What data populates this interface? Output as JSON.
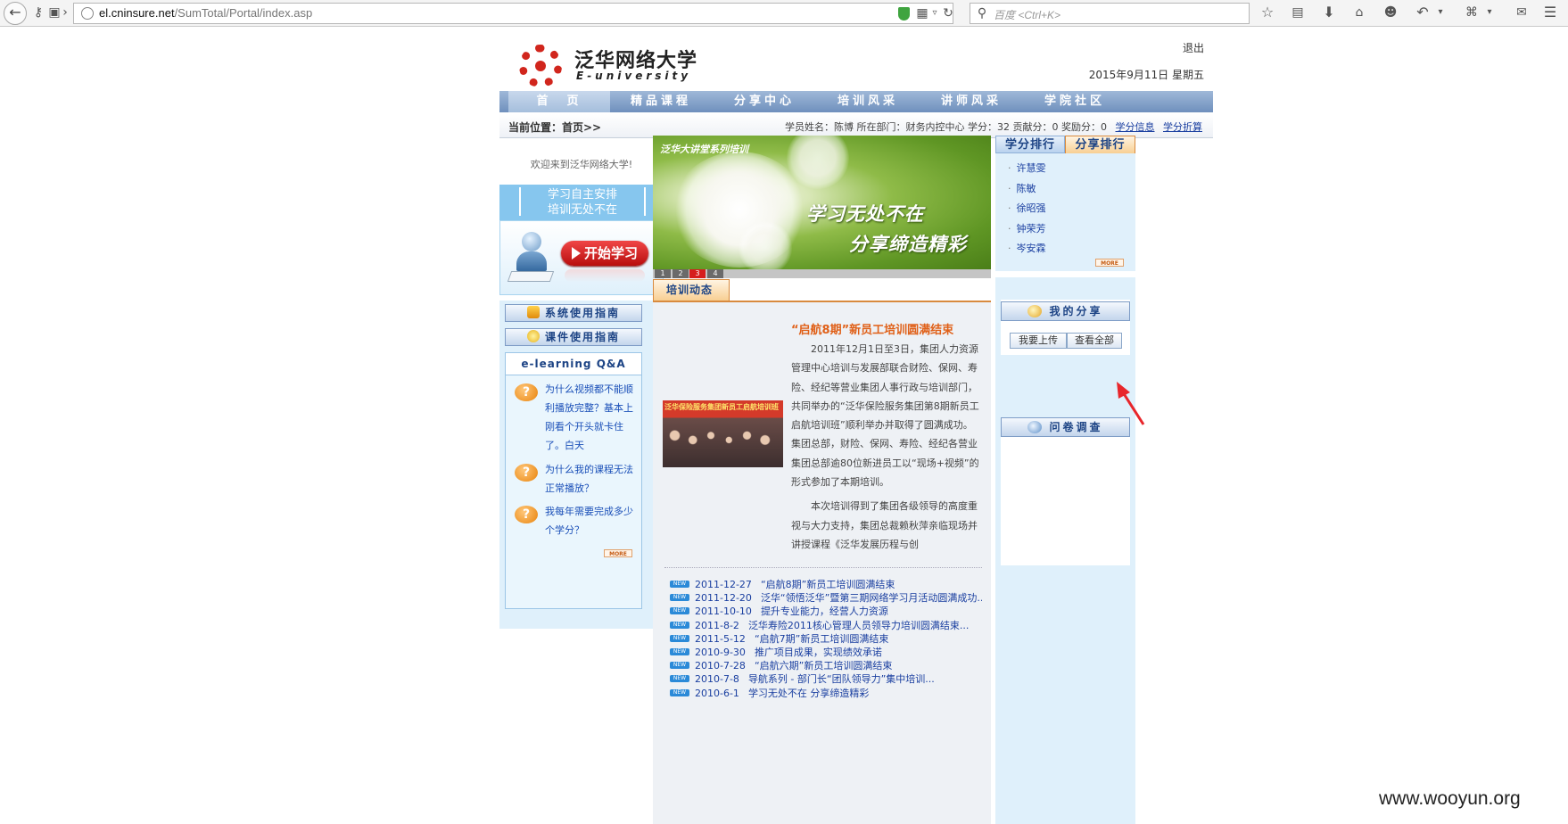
{
  "browser": {
    "url_host": "el.cninsure.net",
    "url_path": "/SumTotal/Portal/index.asp",
    "search_placeholder": "百度 <Ctrl+K>"
  },
  "header": {
    "logo_cn": "泛华网络大学",
    "logo_en": "E-university",
    "logout": "退出",
    "date": "2015年9月11日  星期五"
  },
  "nav": [
    "首　页",
    "精品课程",
    "分享中心",
    "培训风采",
    "讲师风采",
    "学院社区"
  ],
  "crumb": "当前位置：首页>>",
  "userinfo": {
    "text": "学员姓名：陈博  所在部门：财务内控中心  学分：32  贡献分：0  奖励分：0",
    "link1": "学分信息",
    "link2": "学分折算"
  },
  "left": {
    "welcome": "欢迎来到泛华网络大学!",
    "slogan1": "学习自主安排",
    "slogan2": "培训无处不在",
    "start_button": "开始学习",
    "guide1": "系统使用指南",
    "guide2": "课件使用指南",
    "qa_title": "e-learning Q&A",
    "qa": [
      "为什么视频都不能顺利播放完整？基本上刚看个开头就卡住了。白天",
      "为什么我的课程无法正常播放？",
      "我每年需要完成多少个学分？"
    ],
    "more": "MORE"
  },
  "banner": {
    "title": "泛华大讲堂系列培训",
    "line1": "学习无处不在",
    "line2": "分享缔造精彩",
    "pages": [
      "1",
      "2",
      "3",
      "4"
    ],
    "current_page": 3
  },
  "news": {
    "tab": "培训动态",
    "photo_caption": "泛华保险服务集团新员工启航培训班",
    "article_title": "“启航8期”新员工培训圆满结束",
    "article_p1": "2011年12月1日至3日，集团人力资源管理中心培训与发展部联合财险、保网、寿险、经纪等营业集团人事行政与培训部门，共同举办的“泛华保险服务集团第8期新员工启航培训班”顺利举办并取得了圆满成功。集团总部，财险、保网、寿险、经纪各营业集团总部逾80位新进员工以“现场+视频”的形式参加了本期培训。",
    "article_p2": "本次培训得到了集团各级领导的高度重视与大力支持，集团总裁赖秋萍亲临现场并讲授课程《泛华发展历程与创",
    "badge": "NEW",
    "items": [
      {
        "date": "2011-12-27",
        "title": "“启航8期”新员工培训圆满结束"
      },
      {
        "date": "2011-12-20",
        "title": "泛华“领悟泛华”暨第三期网络学习月活动圆满成功..."
      },
      {
        "date": "2011-10-10",
        "title": "提升专业能力，经营人力资源"
      },
      {
        "date": "2011-8-2",
        "title": "泛华寿险2011核心管理人员领导力培训圆满结束..."
      },
      {
        "date": "2011-5-12",
        "title": "“启航7期”新员工培训圆满结束"
      },
      {
        "date": "2010-9-30",
        "title": "推广项目成果，实现绩效承诺"
      },
      {
        "date": "2010-7-28",
        "title": "“启航六期”新员工培训圆满结束"
      },
      {
        "date": "2010-7-8",
        "title": "导航系列 - 部门长“团队领导力”集中培训..."
      },
      {
        "date": "2010-6-1",
        "title": "学习无处不在 分享缔造精彩"
      }
    ]
  },
  "ranking": {
    "tab1": "学分排行",
    "tab2": "分享排行",
    "names": [
      "许慧雯",
      "陈敏",
      "徐昭强",
      "钟荣芳",
      "岑安霖"
    ],
    "more": "MORE"
  },
  "share": {
    "title": "我的分享",
    "upload": "我要上传",
    "view_all": "查看全部",
    "survey": "问卷调查"
  },
  "watermark": "www.wooyun.org",
  "colors": {
    "nav": "#7f9fc9",
    "accent_orange": "#e06018",
    "link": "#1a3fa0",
    "panel": "#dff0fb",
    "annotation_arrow": "#e8262b"
  }
}
